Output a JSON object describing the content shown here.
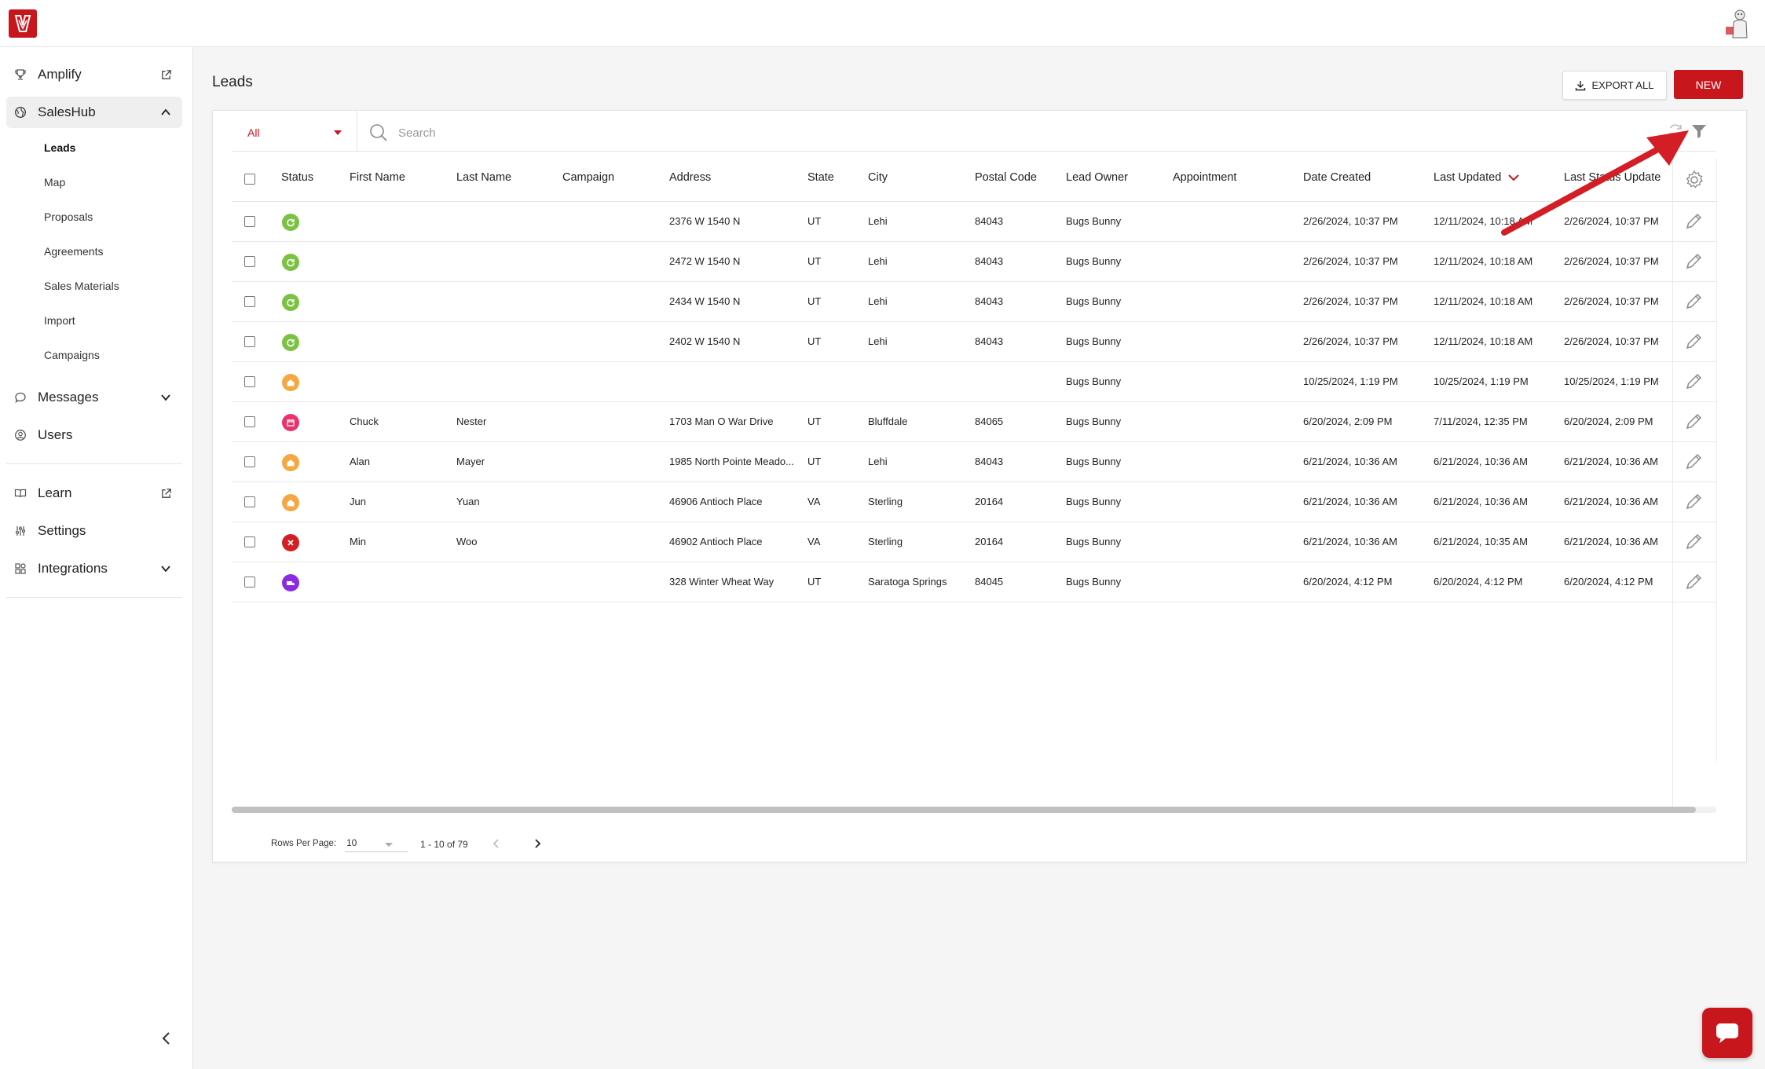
{
  "sidebar": {
    "items": [
      {
        "label": "Amplify"
      },
      {
        "label": "SalesHub"
      },
      {
        "label": "Messages"
      },
      {
        "label": "Users"
      },
      {
        "label": "Learn"
      },
      {
        "label": "Settings"
      },
      {
        "label": "Integrations"
      }
    ],
    "subitems": [
      "Leads",
      "Map",
      "Proposals",
      "Agreements",
      "Sales Materials",
      "Import",
      "Campaigns"
    ]
  },
  "page": {
    "title": "Leads",
    "export_label": "EXPORT ALL",
    "new_label": "NEW"
  },
  "filter": {
    "selected": "All",
    "search_placeholder": "Search"
  },
  "table": {
    "columns": [
      "Status",
      "First Name",
      "Last Name",
      "Campaign",
      "Address",
      "State",
      "City",
      "Postal Code",
      "Lead Owner",
      "Appointment",
      "Date Created",
      "Last Updated",
      "Last Status Update"
    ],
    "sorted_column": "Last Updated",
    "status_colors": {
      "green": "#7cc242",
      "orange": "#f5a742",
      "pink": "#e8336d",
      "red": "#d41e25",
      "purple": "#8a2be2"
    },
    "rows": [
      {
        "status": "green",
        "first": "",
        "last": "",
        "campaign": "",
        "address": "2376 W 1540 N",
        "state": "UT",
        "city": "Lehi",
        "postal": "84043",
        "owner": "Bugs Bunny",
        "appointment": "",
        "created": "2/26/2024, 10:37 PM",
        "updated": "12/11/2024, 10:18 AM",
        "status_update": "2/26/2024, 10:37 PM"
      },
      {
        "status": "green",
        "first": "",
        "last": "",
        "campaign": "",
        "address": "2472 W 1540 N",
        "state": "UT",
        "city": "Lehi",
        "postal": "84043",
        "owner": "Bugs Bunny",
        "appointment": "",
        "created": "2/26/2024, 10:37 PM",
        "updated": "12/11/2024, 10:18 AM",
        "status_update": "2/26/2024, 10:37 PM"
      },
      {
        "status": "green",
        "first": "",
        "last": "",
        "campaign": "",
        "address": "2434 W 1540 N",
        "state": "UT",
        "city": "Lehi",
        "postal": "84043",
        "owner": "Bugs Bunny",
        "appointment": "",
        "created": "2/26/2024, 10:37 PM",
        "updated": "12/11/2024, 10:18 AM",
        "status_update": "2/26/2024, 10:37 PM"
      },
      {
        "status": "green",
        "first": "",
        "last": "",
        "campaign": "",
        "address": "2402 W 1540 N",
        "state": "UT",
        "city": "Lehi",
        "postal": "84043",
        "owner": "Bugs Bunny",
        "appointment": "",
        "created": "2/26/2024, 10:37 PM",
        "updated": "12/11/2024, 10:18 AM",
        "status_update": "2/26/2024, 10:37 PM"
      },
      {
        "status": "orange",
        "first": "",
        "last": "",
        "campaign": "",
        "address": "",
        "state": "",
        "city": "",
        "postal": "",
        "owner": "Bugs Bunny",
        "appointment": "",
        "created": "10/25/2024, 1:19 PM",
        "updated": "10/25/2024, 1:19 PM",
        "status_update": "10/25/2024, 1:19 PM"
      },
      {
        "status": "pink",
        "first": "Chuck",
        "last": "Nester",
        "campaign": "",
        "address": "1703 Man O War Drive",
        "state": "UT",
        "city": "Bluffdale",
        "postal": "84065",
        "owner": "Bugs Bunny",
        "appointment": "",
        "created": "6/20/2024, 2:09 PM",
        "updated": "7/11/2024, 12:35 PM",
        "status_update": "6/20/2024, 2:09 PM"
      },
      {
        "status": "orange",
        "first": "Alan",
        "last": "Mayer",
        "campaign": "",
        "address": "1985 North Pointe Meado...",
        "state": "UT",
        "city": "Lehi",
        "postal": "84043",
        "owner": "Bugs Bunny",
        "appointment": "",
        "created": "6/21/2024, 10:36 AM",
        "updated": "6/21/2024, 10:36 AM",
        "status_update": "6/21/2024, 10:36 AM"
      },
      {
        "status": "orange",
        "first": "Jun",
        "last": "Yuan",
        "campaign": "",
        "address": "46906 Antioch Place",
        "state": "VA",
        "city": "Sterling",
        "postal": "20164",
        "owner": "Bugs Bunny",
        "appointment": "",
        "created": "6/21/2024, 10:36 AM",
        "updated": "6/21/2024, 10:36 AM",
        "status_update": "6/21/2024, 10:36 AM"
      },
      {
        "status": "red",
        "first": "Min",
        "last": "Woo",
        "campaign": "",
        "address": "46902 Antioch Place",
        "state": "VA",
        "city": "Sterling",
        "postal": "20164",
        "owner": "Bugs Bunny",
        "appointment": "",
        "created": "6/21/2024, 10:36 AM",
        "updated": "6/21/2024, 10:35 AM",
        "status_update": "6/21/2024, 10:36 AM"
      },
      {
        "status": "purple",
        "first": "",
        "last": "",
        "campaign": "",
        "address": "328 Winter Wheat Way",
        "state": "UT",
        "city": "Saratoga Springs",
        "postal": "84045",
        "owner": "Bugs Bunny",
        "appointment": "",
        "created": "6/20/2024, 4:12 PM",
        "updated": "6/20/2024, 4:12 PM",
        "status_update": "6/20/2024, 4:12 PM"
      }
    ]
  },
  "pagination": {
    "rows_per_page_label": "Rows Per Page:",
    "rows_per_page": "10",
    "range": "1 - 10 of 79"
  },
  "colors": {
    "brand": "#c8161d"
  }
}
